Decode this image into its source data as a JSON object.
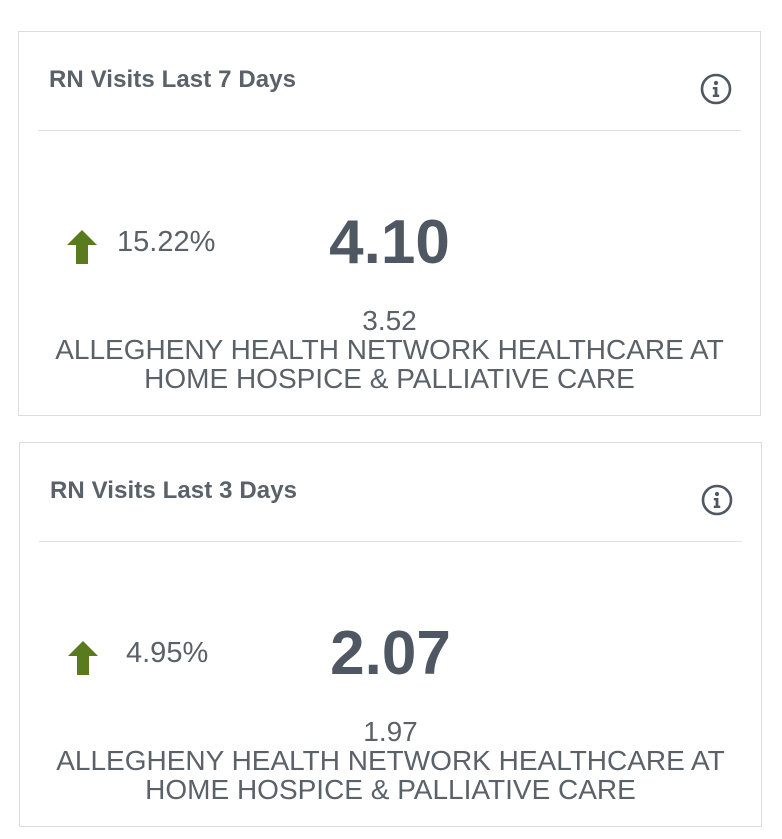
{
  "cards": [
    {
      "title": "RN Visits Last 7 Days",
      "info_icon": "info-circle-icon",
      "trend": {
        "direction": "up",
        "arrow_icon": "arrow-up-icon",
        "percent": "15.22%",
        "color": "#5a7a1e"
      },
      "value": "4.10",
      "prior_value": "3.52",
      "org_name": "ALLEGHENY HEALTH NETWORK HEALTHCARE AT HOME HOSPICE & PALLIATIVE CARE"
    },
    {
      "title": "RN Visits Last 3 Days",
      "info_icon": "info-circle-icon",
      "trend": {
        "direction": "up",
        "arrow_icon": "arrow-up-icon",
        "percent": "4.95%",
        "color": "#5a7a1e"
      },
      "value": "2.07",
      "prior_value": "1.97",
      "org_name": "ALLEGHENY HEALTH NETWORK HEALTHCARE AT HOME HOSPICE & PALLIATIVE CARE"
    }
  ]
}
